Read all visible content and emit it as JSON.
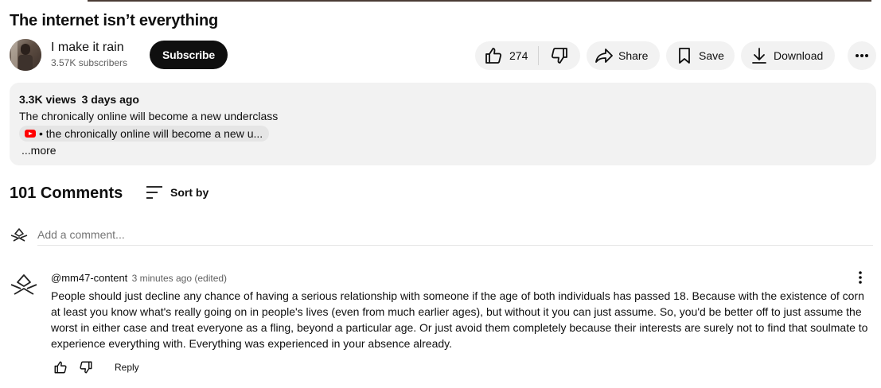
{
  "video": {
    "title": "The internet isn’t everything"
  },
  "channel": {
    "name": "I make it rain",
    "subscribers": "3.57K subscribers",
    "subscribe_label": "Subscribe"
  },
  "actions": {
    "like_count": "274",
    "share_label": "Share",
    "save_label": "Save",
    "download_label": "Download"
  },
  "description": {
    "views": "3.3K views",
    "date": "3 days ago",
    "text": "The chronically online will become a new underclass",
    "chip_text": "• the chronically online will become a new u...",
    "more_label": "...more"
  },
  "comments": {
    "count_label": "101 Comments",
    "sort_label": "Sort by",
    "add_placeholder": "Add a comment...",
    "items": [
      {
        "author": "@mm47-content",
        "time": "3 minutes ago (edited)",
        "text": "People should just decline any chance of having a serious relationship with someone if the age of both individuals has passed 18. Because with the existence of corn at least you know what's really going on in people's lives (even from much earlier ages), but without it you can just assume. So, you'd be better off to just assume the worst in either case and treat everyone as a fling, beyond a particular age. Or just avoid them completely because their interests are surely not to find that soulmate to experience everything with. Everything was experienced in your absence already.",
        "reply_label": "Reply"
      }
    ]
  },
  "icons": {
    "like": "thumbs-up-icon",
    "dislike": "thumbs-down-icon",
    "share": "share-arrow-icon",
    "save": "bookmark-icon",
    "download": "download-icon",
    "more": "more-horiz-icon",
    "sort": "sort-lines-icon",
    "comment_more": "more-vert-icon"
  },
  "colors": {
    "subscribe_bg": "#0f0f0f",
    "pill_bg": "#f2f2f2",
    "secondary_text": "#606060",
    "youtube_red": "#ff0000"
  }
}
